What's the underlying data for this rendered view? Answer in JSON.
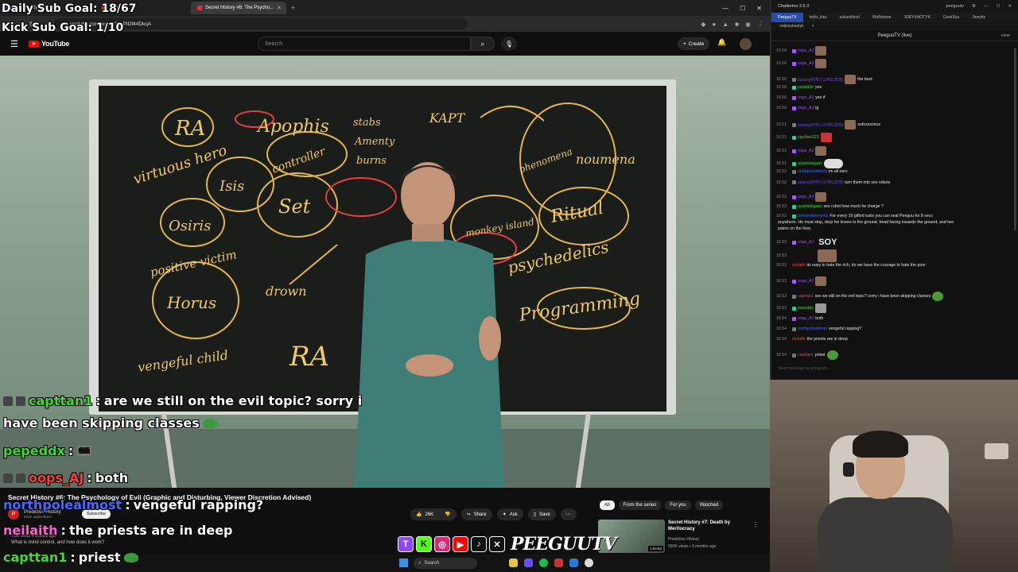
{
  "overlay": {
    "daily_goal": "Daily Sub Goal: 18/67",
    "kick_goal": "Kick Sub Goal: 1/10",
    "chat": [
      {
        "user": "capttan1",
        "sep": ":",
        "text": "are we still on the evil topic? sorry i",
        "cont": "have been skipping classes"
      },
      {
        "user": "pepeddx",
        "sep": ":",
        "text": "GG"
      },
      {
        "user": "oops_AJ",
        "sep": ":",
        "text": "both"
      },
      {
        "user": "northpolealmost",
        "sep": ":",
        "text": "vengeful rapping?"
      },
      {
        "user": "neilaith",
        "sep": ":",
        "text": "the priests are in deep"
      },
      {
        "user": "capttan1",
        "sep": ":",
        "text": "priest"
      }
    ],
    "brand": "PEEGUUTV"
  },
  "browser": {
    "tabs": [
      {
        "label": "(1) Jinnytty - Twitch",
        "icon": "twitch-icon",
        "active": false
      },
      {
        "label": "YouTube",
        "icon": "youtube-icon",
        "active": false
      },
      {
        "label": "Secret History #6: The Psycho...",
        "icon": "youtube-icon",
        "active": true
      }
    ],
    "url": "youtube.com/watch?v=PtDf44DkqA"
  },
  "youtube": {
    "logo_text": "YouTube",
    "search_placeholder": "Search",
    "create_label": "Create",
    "video_title": "Secret History #6: The Psychology of Evil (Graphic and Disturbing, Viewer Discretion Advised)",
    "channel": "Predictive History",
    "subscribers": "931K subscribers",
    "subscribe_label": "Subscribe",
    "likes": "26K",
    "share_label": "Share",
    "ask_label": "Ask",
    "save_label": "Save",
    "desc_views": "7.0K views 4 months ago",
    "desc_question": "What is mind control, and how does it work?",
    "chips": [
      {
        "label": "All",
        "active": true
      },
      {
        "label": "From the series",
        "active": false
      },
      {
        "label": "For you",
        "active": false
      },
      {
        "label": "Watched",
        "active": false
      }
    ],
    "rec": {
      "title": "Secret History #7: Death by Meritocracy",
      "channel": "Predictive History",
      "meta": "550K views • 3 months ago",
      "duration": "1:04:52"
    }
  },
  "board_words": [
    "RA",
    "Apophis",
    "virtuous hero",
    "controller",
    "Isis",
    "Set",
    "Osiris",
    "positive victim",
    "Horus",
    "vengeful child",
    "RA",
    "stabs",
    "Amenty",
    "burns",
    "drown",
    "KAPT",
    "phenomena",
    "noumena",
    "Ritual",
    "psychedelics",
    "Programming",
    "monkey island"
  ],
  "taskbar": {
    "search_label": "Search"
  },
  "chatterino": {
    "title": "Chatterino 2.5.3",
    "user": "peeguutv",
    "tabs": [
      {
        "label": "PeeguuTV",
        "active": true
      },
      {
        "label": "hello_kiss",
        "active": false
      },
      {
        "label": "sukasblood",
        "active": false
      },
      {
        "label": "Wolfsbane",
        "active": false
      },
      {
        "label": "JOEYKAOTYK",
        "active": false
      },
      {
        "label": "CookSus",
        "active": false
      },
      {
        "label": "Jinnytty",
        "active": false
      }
    ],
    "sub_tab": "notjoeykaotyk",
    "channel_header": "PeeguuTV (live)",
    "modes": "none",
    "input_placeholder": "Send message as peeguutv...",
    "messages": [
      {
        "ts": "16:50",
        "user": "oops_AJ",
        "color": "#a64cff",
        "text": ""
      },
      {
        "ts": "16:50",
        "user": "oops_AJ",
        "color": "#a64cff",
        "text": ""
      },
      {
        "ts": "16:50",
        "user": "zzxcvy(러지나고쳐드리라)",
        "color": "#7a4cff",
        "text": "the best"
      },
      {
        "ts": "16:50",
        "user": "pepeddx",
        "color": "#3ddc2f",
        "text": "yes"
      },
      {
        "ts": "16:50",
        "user": "oops_AJ",
        "color": "#a64cff",
        "text": "yes if"
      },
      {
        "ts": "16:50",
        "user": "oops_AJ",
        "color": "#a64cff",
        "text": "ig"
      },
      {
        "ts": "16:51",
        "user": "zzxcvy(러지나고쳐드리라)",
        "color": "#7a4cff",
        "text": "subconcious"
      },
      {
        "ts": "16:51",
        "user": "spydast123",
        "color": "#3ddc2f",
        "text": ""
      },
      {
        "ts": "16:51",
        "user": "oops_AJ",
        "color": "#a64cff",
        "text": ""
      },
      {
        "ts": "16:51",
        "user": "asianboiganz",
        "color": "#3ddc2f",
        "text": ""
      },
      {
        "ts": "16:52",
        "user": "northpolealmost",
        "color": "#3f6bff",
        "text": "im all ears"
      },
      {
        "ts": "16:52",
        "user": "zzxcvy(러지나고쳐드리라)",
        "color": "#7a4cff",
        "text": "turn them into sex robots"
      },
      {
        "ts": "16:52",
        "user": "oops_AJ",
        "color": "#a64cff",
        "text": ""
      },
      {
        "ts": "16:52",
        "user": "asianboiganz",
        "color": "#3ddc2f",
        "text": "sex robot how much he charge ?"
      },
      {
        "ts": "16:52",
        "user": "StreamElements",
        "color": "#3f6bff",
        "text": "For every 10 gifted subs you can seal Peeguu for 8 secs",
        "cont": "anywhere. He must stop, drop his knees to the ground, head facing towards the ground, and two",
        "cont2": "palms on the floor."
      },
      {
        "ts": "16:52",
        "user": "oops_AJ",
        "color": "#a64cff",
        "text": "SOY"
      },
      {
        "ts": "16:53",
        "user": "",
        "color": "#ccc",
        "text": ""
      },
      {
        "ts": "16:53",
        "user": "neilaith",
        "color": "#ff3b3b",
        "text": "its easy to hate the rich, do we have the courage to hate the poor"
      },
      {
        "ts": "16:53",
        "user": "oops_AJ",
        "color": "#a64cff",
        "text": ""
      },
      {
        "ts": "16:53",
        "user": "capttan1",
        "color": "#ff3b3b",
        "text": "are we still on the evil topic? sorry i have been skipping classes"
      },
      {
        "ts": "16:53",
        "user": "pepeddx",
        "color": "#3ddc2f",
        "text": ""
      },
      {
        "ts": "16:54",
        "user": "oops_AJ",
        "color": "#a64cff",
        "text": "both"
      },
      {
        "ts": "16:54",
        "user": "northpolealmost",
        "color": "#3f6bff",
        "text": "vengeful rapping?"
      },
      {
        "ts": "16:54",
        "user": "neilaith",
        "color": "#ff3b3b",
        "text": "the priests are in deep"
      },
      {
        "ts": "16:54",
        "user": "capttan1",
        "color": "#ff3b3b",
        "text": "priest"
      }
    ]
  }
}
